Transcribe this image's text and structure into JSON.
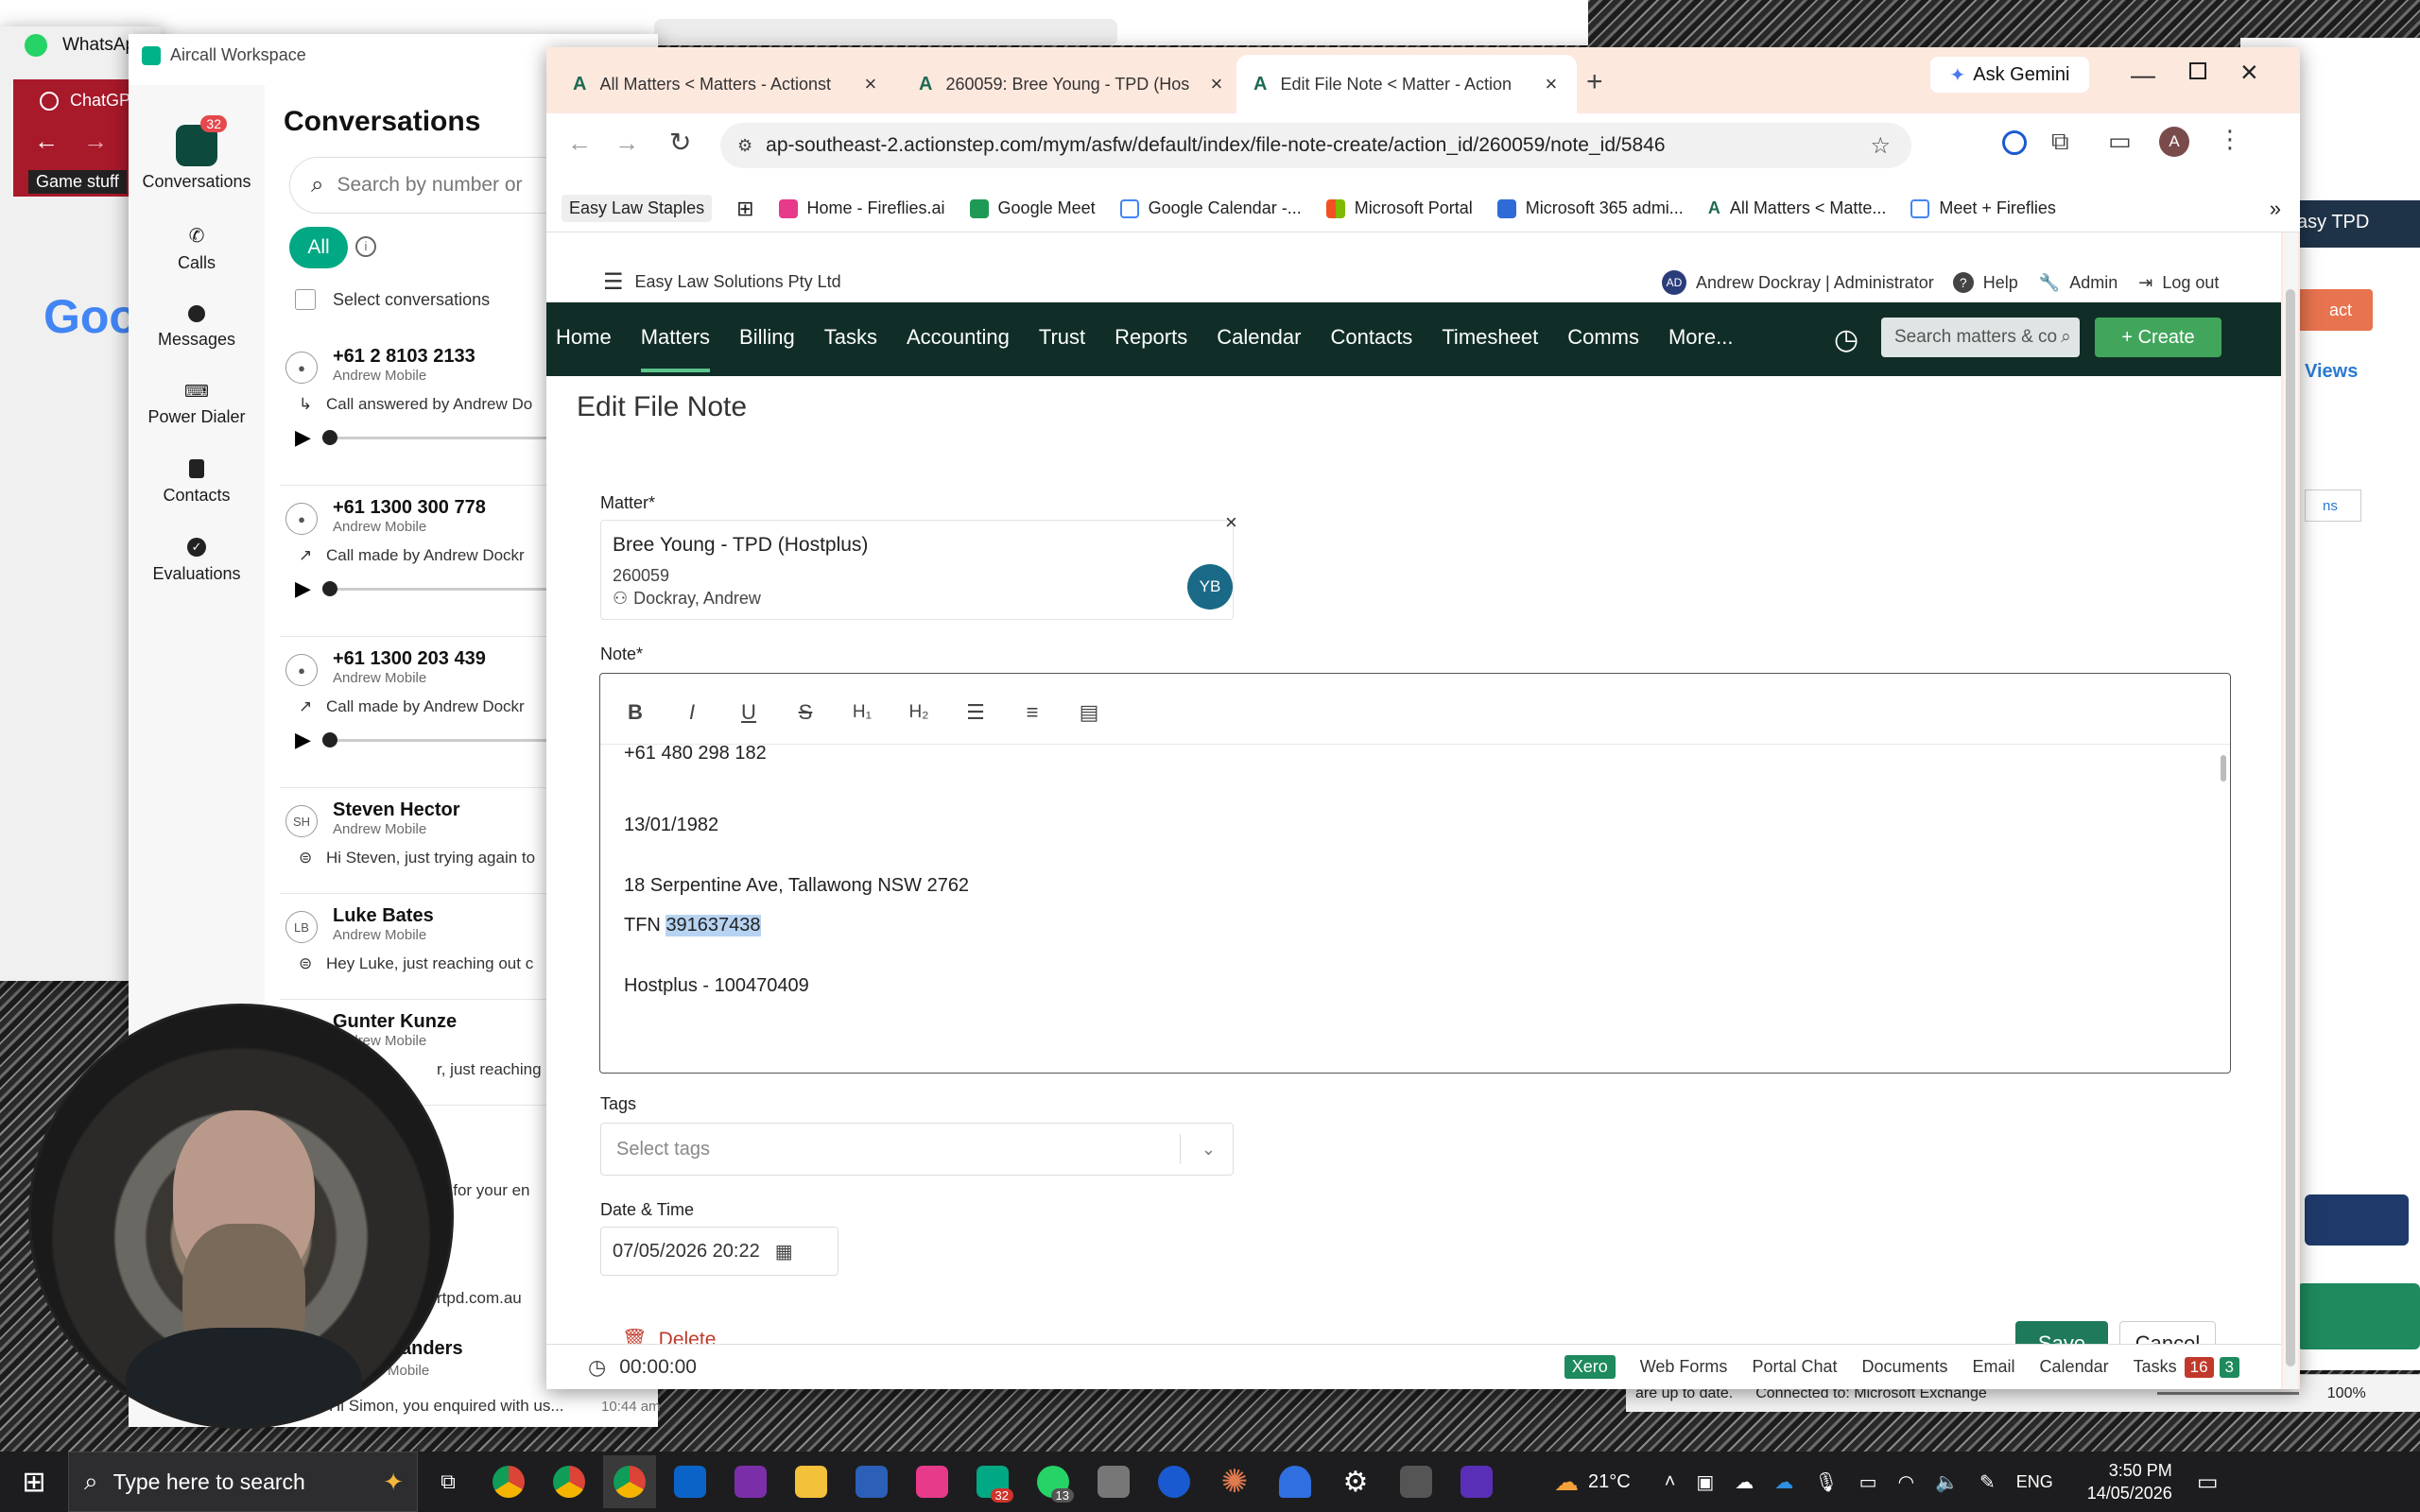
{
  "whatsapp": {
    "title": "WhatsApp",
    "chatgpt": "ChatGPT",
    "game": "Game stuff",
    "google": "Goog"
  },
  "aircall": {
    "title": "Aircall Workspace",
    "heading": "Conversations",
    "search_placeholder": "Search by number or",
    "filter_all": "All",
    "select_label": "Select conversations",
    "nav": [
      {
        "label": "Conversations",
        "badge": "32"
      },
      {
        "label": "Calls"
      },
      {
        "label": "Messages"
      },
      {
        "label": "Power Dialer"
      },
      {
        "label": "Contacts"
      },
      {
        "label": "Evaluations"
      }
    ],
    "items": [
      {
        "title": "+61 2 8103 2133",
        "sub": "Andrew Mobile",
        "line": "Call answered by Andrew Do"
      },
      {
        "title": "+61 1300 300 778",
        "sub": "Andrew Mobile",
        "line": "Call made by Andrew Dockr"
      },
      {
        "title": "+61 1300 203 439",
        "sub": "Andrew Mobile",
        "line": "Call made by Andrew Dockr"
      },
      {
        "title": "Steven Hector",
        "sub": "Andrew Mobile",
        "line": "Hi Steven, just trying again to",
        "initials": "SH"
      },
      {
        "title": "Luke Bates",
        "sub": "Andrew Mobile",
        "line": "Hey Luke, just reaching out c",
        "initials": "LB"
      },
      {
        "title": "Gunter Kunze",
        "sub": "Andrew Mobile",
        "line": "r, just reaching ou"
      }
    ],
    "extra1": "s for your en",
    "extra2": "rtpd.com.au",
    "extra3": "anders",
    "extra4": "Mobile",
    "extra5": "Hi Simon, you enquired with us...",
    "extra6": "10:44 am"
  },
  "browser": {
    "tabs": [
      {
        "label": "All Matters < Matters - Actionst"
      },
      {
        "label": "260059: Bree Young - TPD (Hos"
      },
      {
        "label": "Edit File Note < Matter - Action"
      }
    ],
    "gemini": "Ask Gemini",
    "url": "ap-southeast-2.actionstep.com/mym/asfw/default/index/file-note-create/action_id/260059/note_id/5846",
    "profile": "A",
    "bookmarks": [
      "Easy Law Staples",
      "Home - Fireflies.ai",
      "Google Meet",
      "Google Calendar -...",
      "Microsoft Portal",
      "Microsoft 365 admi...",
      "All Matters < Matte...",
      "Meet + Fireflies"
    ]
  },
  "actionstep": {
    "org": "Easy Law Solutions Pty Ltd",
    "user_initials": "AD",
    "user": "Andrew Dockray | Administrator",
    "help": "Help",
    "admin": "Admin",
    "logout": "Log out",
    "nav": [
      "Home",
      "Matters",
      "Billing",
      "Tasks",
      "Accounting",
      "Trust",
      "Reports",
      "Calendar",
      "Contacts",
      "Timesheet",
      "Comms",
      "More..."
    ],
    "search_placeholder": "Search matters & co",
    "create": "+ Create",
    "page_title": "Edit File Note",
    "matter_label": "Matter*",
    "matter_name": "Bree Young - TPD (Hostplus)",
    "matter_id": "260059",
    "matter_owner": "Dockray, Andrew",
    "matter_initials": "YB",
    "note_label": "Note*",
    "note_lines": [
      "+61 480 298 182",
      "13/01/1982",
      "18 Serpentine Ave, Tallawong NSW 2762",
      "TFN ",
      "391637438",
      "Hostplus - 100470409"
    ],
    "tags_label": "Tags",
    "tags_placeholder": "Select tags",
    "datetime_label": "Date & Time",
    "datetime_value": "07/05/2026 20:22",
    "delete": "Delete",
    "save": "Save",
    "cancel": "Cancel",
    "timer": "00:00:00",
    "footer": {
      "xero": "Xero",
      "links": [
        "Web Forms",
        "Portal Chat",
        "Documents",
        "Email",
        "Calendar",
        "Tasks"
      ],
      "tasks_red": "16",
      "tasks_green": "3"
    }
  },
  "right_bg": {
    "tab": "asy TPD",
    "act": "act",
    "views": "Views",
    "ns": "ns"
  },
  "outlook": {
    "status1": "are up to date.",
    "status2": "Connected to: Microsoft Exchange",
    "zoom": "100%"
  },
  "taskbar": {
    "search": "Type here to search",
    "weather": "21°C",
    "lang": "ENG",
    "time": "3:50 PM",
    "date": "14/05/2026",
    "aircall_badge": "32",
    "whatsapp_badge": "13"
  }
}
